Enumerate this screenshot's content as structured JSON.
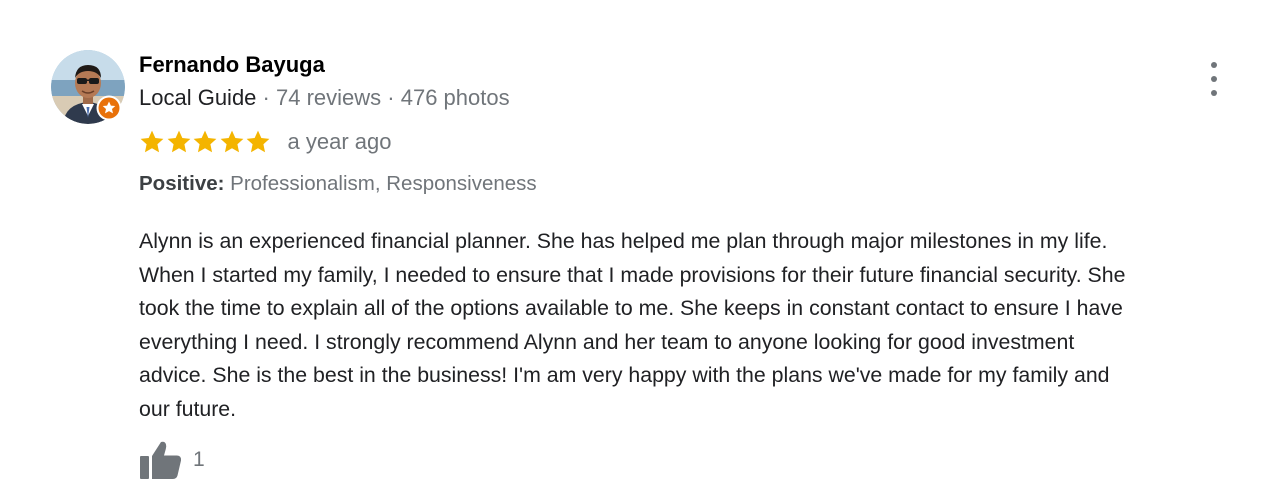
{
  "author": {
    "name": "Fernando Bayuga",
    "guide_label": "Local Guide",
    "reviews_count": "74 reviews",
    "photos_count": "476 photos",
    "separator": "·"
  },
  "rating": {
    "stars": 5,
    "max_stars": 5,
    "star_color": "#f4b400",
    "date": "a year ago"
  },
  "highlights": {
    "label": "Positive:",
    "value": "Professionalism, Responsiveness"
  },
  "review": {
    "lines": [
      "Alynn is an experienced financial planner. She has helped me plan through major milestones in my life.",
      "When I started my family, I needed to ensure that I made provisions for their future financial security. She",
      "took the time to explain all of the options available to me. She keeps in constant contact to ensure I have",
      "everything I need. I strongly recommend Alynn and her team to anyone looking for good investment",
      "advice. She is the best in the business! I'm am very happy with the plans we've made for my family and",
      "our future."
    ]
  },
  "likes": {
    "count": "1",
    "icon": "thumbs-up-icon"
  },
  "icons": {
    "more": "more-vert-icon",
    "badge": "local-guide-badge-icon",
    "badge_color": "#e8710a"
  }
}
